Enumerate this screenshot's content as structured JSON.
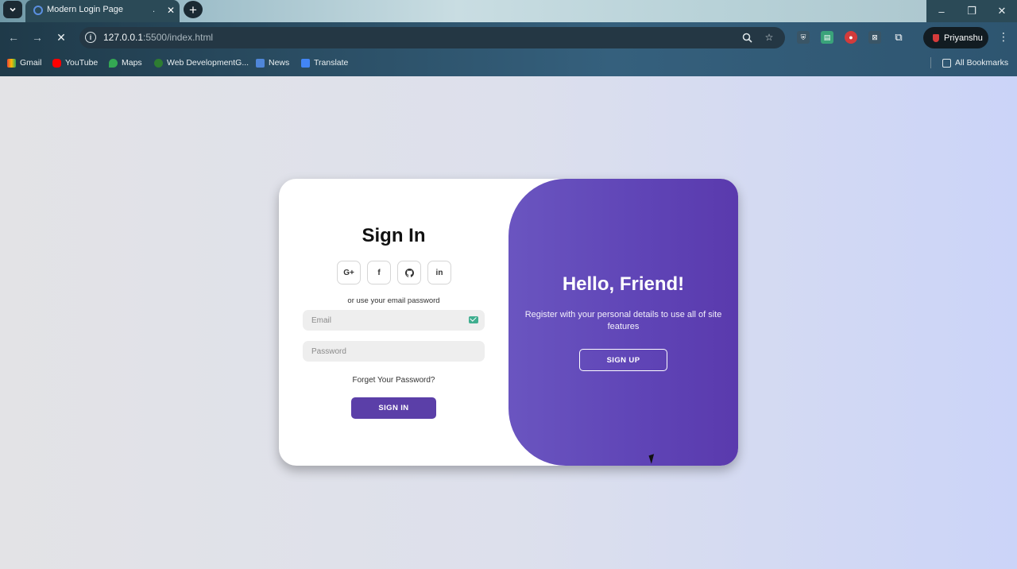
{
  "browser": {
    "tab_title": "Modern Login Page",
    "url_host": "127.0.0.1",
    "url_rest": ":5500/index.html",
    "profile_name": "Priyanshu",
    "bookmarks": [
      "Gmail",
      "YouTube",
      "Maps",
      "Web DevelopmentG...",
      "News",
      "Translate"
    ],
    "all_bookmarks": "All Bookmarks",
    "icons": {
      "tab_menu": "chevron-down-icon",
      "new_tab": "plus-icon",
      "back": "back-arrow-icon",
      "forward": "forward-arrow-icon",
      "stop": "close-icon",
      "zoom": "magnifier-icon",
      "bookmark_star": "star-icon"
    }
  },
  "signin": {
    "title": "Sign In",
    "social": [
      "G+",
      "f",
      "gh",
      "in"
    ],
    "alt_text": "or use your email password",
    "email_placeholder": "Email",
    "password_placeholder": "Password",
    "forgot": "Forget Your Password?",
    "button": "SIGN IN"
  },
  "toggle": {
    "title": "Hello, Friend!",
    "subtitle": "Register with your personal details to use all of site features",
    "button": "SIGN UP"
  },
  "colors": {
    "accent": "#5b3fa8",
    "panel_start": "#6a55c0",
    "panel_end": "#5a3aad"
  }
}
